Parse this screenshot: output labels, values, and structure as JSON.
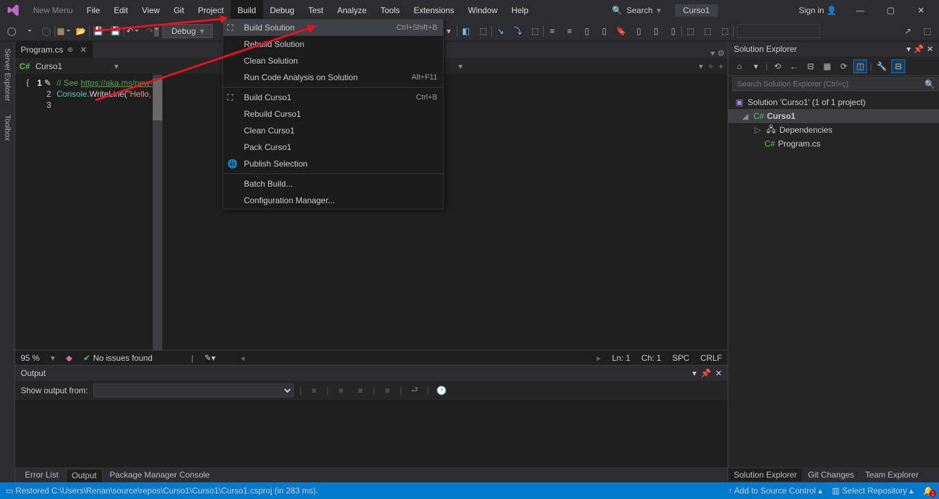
{
  "menubar": {
    "newmenu": "New Menu",
    "items": [
      "File",
      "Edit",
      "View",
      "Git",
      "Project",
      "Build",
      "Debug",
      "Test",
      "Analyze",
      "Tools",
      "Extensions",
      "Window",
      "Help"
    ],
    "active": "Build",
    "search": "Search",
    "project": "Curso1",
    "signin": "Sign in"
  },
  "toolbar": {
    "debug": "Debug"
  },
  "dropdown": {
    "items": [
      {
        "label": "Build Solution",
        "shortcut": "Ctrl+Shift+B",
        "icon": "⛶",
        "hl": true
      },
      {
        "label": "Rebuild Solution"
      },
      {
        "label": "Clean Solution"
      },
      {
        "label": "Run Code Analysis on Solution",
        "shortcut": "Alt+F11"
      },
      {
        "sep": true
      },
      {
        "label": "Build Curso1",
        "shortcut": "Ctrl+B",
        "icon": "⛶"
      },
      {
        "label": "Rebuild Curso1"
      },
      {
        "label": "Clean Curso1"
      },
      {
        "label": "Pack Curso1"
      },
      {
        "label": "Publish Selection",
        "icon": "🌐"
      },
      {
        "sep": true
      },
      {
        "label": "Batch Build..."
      },
      {
        "label": "Configuration Manager..."
      }
    ]
  },
  "sidebar": {
    "tabs": [
      "Server Explorer",
      "Toolbox"
    ]
  },
  "editor": {
    "tab": "Program.cs",
    "nav": "Curso1",
    "lines": {
      "l1a": "// See ",
      "l1b": "https://aka.ms/new-",
      "l2a": "Console",
      "l2b": ".WriteLine(",
      "l2c": "\"Hello,"
    },
    "status": {
      "zoom": "95 %",
      "issues": "No issues found",
      "ln": "Ln: 1",
      "ch": "Ch: 1",
      "spc": "SPC",
      "crlf": "CRLF"
    }
  },
  "output": {
    "title": "Output",
    "from": "Show output from:"
  },
  "bottomtabs": {
    "t1": "Error List",
    "t2": "Output",
    "t3": "Package Manager Console"
  },
  "solution": {
    "title": "Solution Explorer",
    "placeholder": "Search Solution Explorer (Ctrl+ç)",
    "root": "Solution 'Curso1' (1 of 1 project)",
    "proj": "Curso1",
    "deps": "Dependencies",
    "file": "Program.cs",
    "bt1": "Solution Explorer",
    "bt2": "Git Changes",
    "bt3": "Team Explorer"
  },
  "statusbar": {
    "msg": "Restored C:\\Users\\Renan\\source\\repos\\Curso1\\Curso1\\Curso1.csproj (in 283 ms).",
    "source": "Add to Source Control",
    "repo": "Select Repository",
    "bell": "1"
  }
}
